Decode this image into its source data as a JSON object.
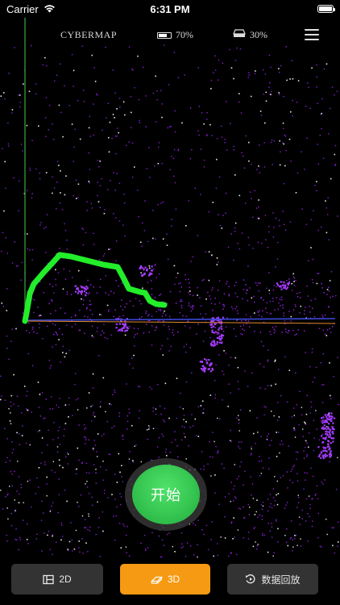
{
  "status_bar": {
    "carrier": "Carrier",
    "time": "6:31 PM",
    "icons": [
      "wifi-icon",
      "ios-battery-icon"
    ]
  },
  "header": {
    "title": "CYBERMAP",
    "battery": {
      "label": "70%",
      "level": 0.7,
      "icon": "battery-icon"
    },
    "storage": {
      "label": "30%",
      "icon": "storage-drive-icon"
    },
    "menu_icon": "hamburger-menu-icon"
  },
  "map": {
    "colors": {
      "background": "#000000",
      "points_primary": "#8a1fd6",
      "points_secondary": "#e6e6e6",
      "trajectory": "#22ee2a",
      "axis_vertical": "#3caa3c",
      "axis_blue": "#3a48d8",
      "axis_orange": "#e68a30"
    }
  },
  "start_button": {
    "label": "开始",
    "color": "#32c24d"
  },
  "toolbar": {
    "buttons": [
      {
        "id": "2d",
        "label": "2D",
        "icon": "2d-map-icon",
        "active": false
      },
      {
        "id": "3d",
        "label": "3D",
        "icon": "3d-cube-icon",
        "active": true,
        "active_color": "#f59a12"
      },
      {
        "id": "replay",
        "label": "数据回放",
        "icon": "replay-icon",
        "active": false
      }
    ]
  }
}
